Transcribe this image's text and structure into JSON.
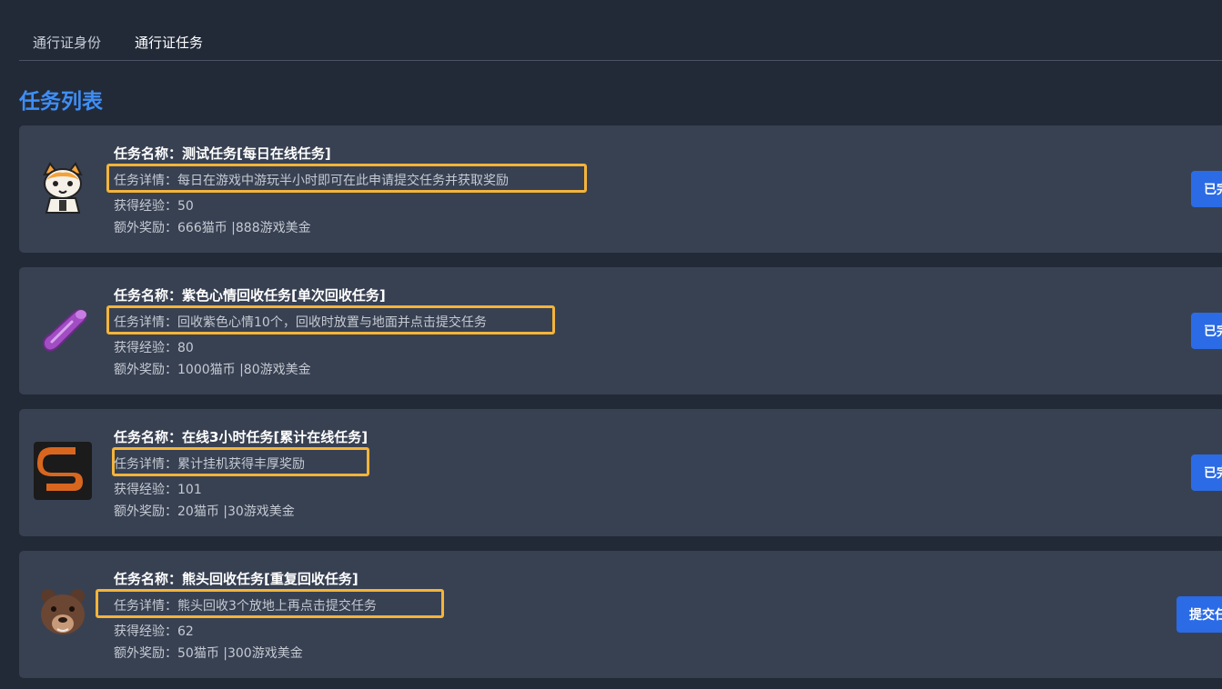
{
  "tabs": [
    {
      "label": "通行证身份"
    },
    {
      "label": "通行证任务"
    }
  ],
  "section_title": "任务列表",
  "tasks": [
    {
      "name": "任务名称：测试任务[每日在线任务]",
      "detail": "任务详情：每日在游戏中游玩半小时即可在此申请提交任务并获取奖励",
      "exp": "获得经验：50",
      "reward": "额外奖励：666猫币 |888游戏美金",
      "button": "已完成",
      "icon": "cartoon-cat-icon"
    },
    {
      "name": "任务名称：紫色心情回收任务[单次回收任务]",
      "detail": "任务详情：回收紫色心情10个，回收时放置与地面并点击提交任务",
      "exp": "获得经验：80",
      "reward": "额外奖励：1000猫币 |80游戏美金",
      "button": "已完成",
      "icon": "purple-item-icon"
    },
    {
      "name": "任务名称：在线3小时任务[累计在线任务]",
      "detail": "任务详情：累计挂机获得丰厚奖励",
      "exp": "获得经验：101",
      "reward": "额外奖励：20猫币 |30游戏美金",
      "button": "已完成",
      "icon": "s-logo-icon"
    },
    {
      "name": "任务名称：熊头回收任务[重复回收任务]",
      "detail": "任务详情：熊头回收3个放地上再点击提交任务",
      "exp": "获得经验：62",
      "reward": "额外奖励：50猫币 |300游戏美金",
      "button": "提交任务",
      "icon": "bear-head-icon"
    }
  ],
  "colors": {
    "background": "#222a38",
    "card": "#384152",
    "accent_title": "#3f8ef5",
    "button": "#2b6be6",
    "highlight_box": "#f4b43a"
  }
}
